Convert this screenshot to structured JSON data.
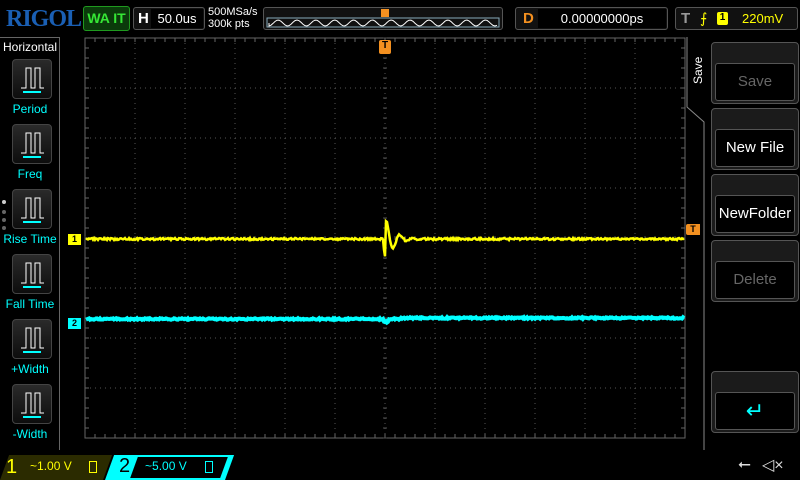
{
  "header": {
    "logo": "RIGOL",
    "run_status": "WA IT",
    "horizontal_key": "H",
    "timebase": "50.0us",
    "sample_rate": "500MSa/s",
    "memory_depth": "300k pts",
    "delay_key": "D",
    "delay": "0.00000000ps",
    "trigger_key": "T",
    "trigger_slope": "rising-edge-icon",
    "trigger_source": "1",
    "trigger_level": "220mV"
  },
  "left_menu": {
    "title": "Horizontal",
    "items": [
      {
        "label": "Period",
        "icon": "period-icon"
      },
      {
        "label": "Freq",
        "icon": "freq-icon"
      },
      {
        "label": "Rise Time",
        "icon": "rise-time-icon"
      },
      {
        "label": "Fall Time",
        "icon": "fall-time-icon"
      },
      {
        "label": "+Width",
        "icon": "positive-width-icon"
      },
      {
        "label": "-Width",
        "icon": "negative-width-icon"
      }
    ]
  },
  "right_menu": {
    "title": "Save",
    "items": [
      {
        "label": "Save",
        "enabled": false
      },
      {
        "label": "New File",
        "enabled": true
      },
      {
        "label": "NewFolder",
        "enabled": true
      },
      {
        "label": "Delete",
        "enabled": false
      },
      {
        "label": "",
        "enabled": false
      },
      {
        "label": "",
        "icon": "return-icon",
        "enabled": true
      }
    ]
  },
  "channels": [
    {
      "number": "1",
      "coupling": "~",
      "scale": "1.00 V",
      "color": "#ffff00"
    },
    {
      "number": "2",
      "coupling": "~",
      "scale": "5.00 V",
      "color": "#00ffff"
    }
  ],
  "markers": {
    "trigger_position": "T",
    "trigger_level": "T",
    "ch1": "1",
    "ch2": "2"
  },
  "status": {
    "usb": "usb-icon",
    "sound": "mute-icon"
  }
}
